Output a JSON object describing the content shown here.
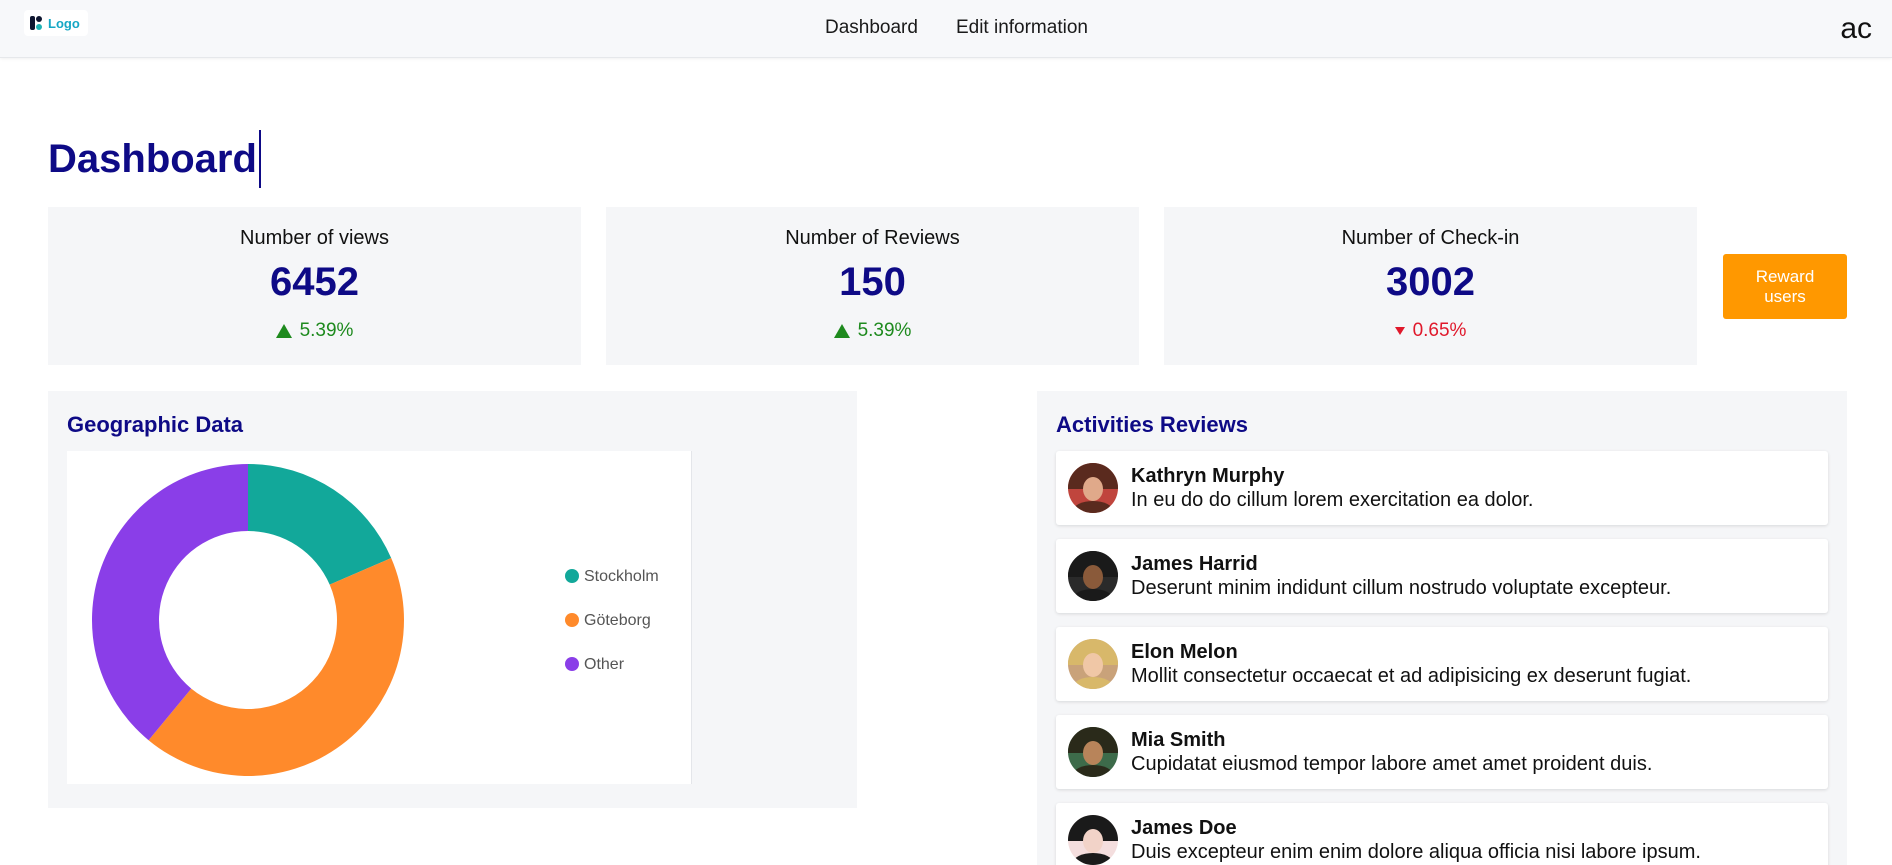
{
  "nav": {
    "logo_text": "Logo",
    "links": [
      "Dashboard",
      "Edit information"
    ],
    "user_initials": "ac"
  },
  "page": {
    "title": "Dashboard"
  },
  "stats": [
    {
      "label": "Number of views",
      "value": "6452",
      "change": "5.39%",
      "direction": "up"
    },
    {
      "label": "Number of Reviews",
      "value": "150",
      "change": "5.39%",
      "direction": "up"
    },
    {
      "label": "Number of Check-in",
      "value": "3002",
      "change": "0.65%",
      "direction": "down"
    }
  ],
  "reward_button": {
    "label": "Reward users"
  },
  "geo": {
    "title": "Geographic Data"
  },
  "chart_data": {
    "type": "pie",
    "donut": true,
    "title": "",
    "legend_position": "right",
    "series": [
      {
        "name": "Stockholm",
        "value": 18.5,
        "color": "#12a89a"
      },
      {
        "name": "Göteborg",
        "value": 42.5,
        "color": "#ff8a2b"
      },
      {
        "name": "Other",
        "value": 39,
        "color": "#8a3ee8"
      }
    ]
  },
  "reviews": {
    "title": "Activities Reviews",
    "items": [
      {
        "name": "Kathryn Murphy",
        "text": "In eu do do cillum lorem exercitation ea dolor.",
        "avatar_colors": [
          "#5a2a1e",
          "#e0a98a",
          "#c0453d"
        ]
      },
      {
        "name": "James Harrid",
        "text": "Deserunt minim indidunt cillum nostrudo voluptate excepteur.",
        "avatar_colors": [
          "#1a1a1a",
          "#8a5a3a",
          "#2a2a2a"
        ]
      },
      {
        "name": "Elon Melon",
        "text": "Mollit consectetur occaecat et ad adipisicing ex deserunt fugiat.",
        "avatar_colors": [
          "#d8b86a",
          "#f0c7a6",
          "#c9a27a"
        ]
      },
      {
        "name": "Mia Smith",
        "text": "Cupidatat eiusmod tempor labore amet amet proident duis.",
        "avatar_colors": [
          "#2a2a1a",
          "#b8845a",
          "#3d6b4a"
        ]
      },
      {
        "name": "James Doe",
        "text": "Duis excepteur enim enim dolore aliqua officia nisi labore ipsum.",
        "avatar_colors": [
          "#1a1a1a",
          "#f2d3c8",
          "#f4dede"
        ]
      }
    ]
  }
}
